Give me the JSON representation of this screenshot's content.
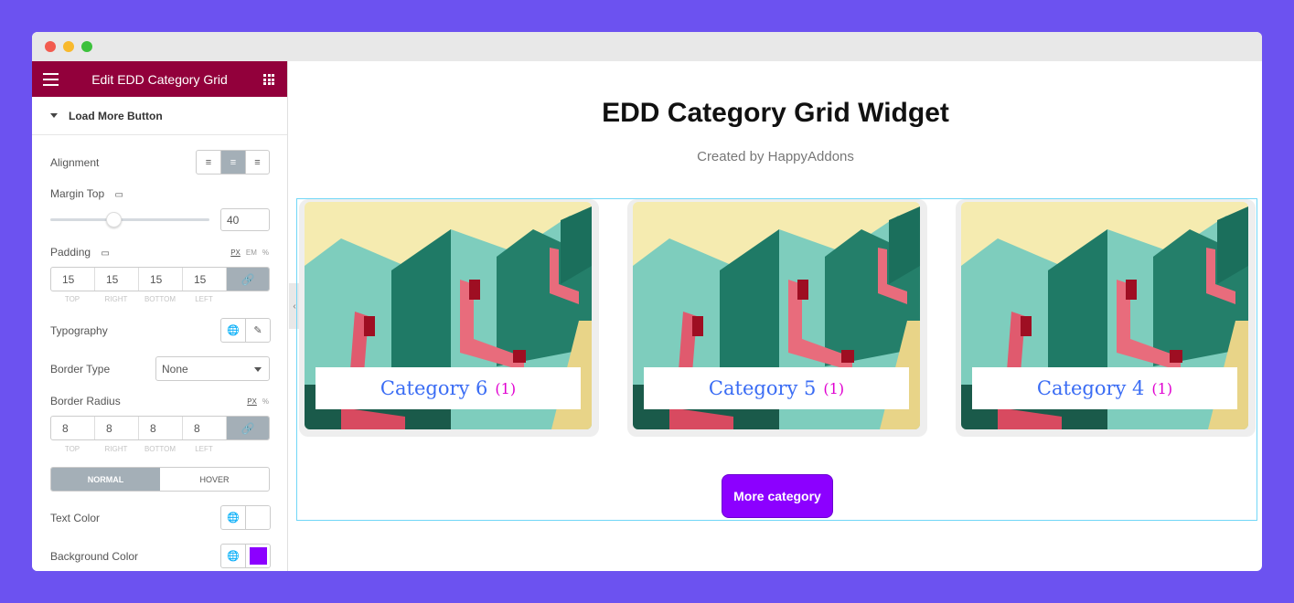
{
  "panel": {
    "title": "Edit EDD Category Grid",
    "section": "Load More Button",
    "alignment_label": "Alignment",
    "margin_top_label": "Margin Top",
    "margin_top_value": "40",
    "margin_top_slider_value": 40,
    "padding_label": "Padding",
    "padding_units": [
      "PX",
      "EM",
      "%"
    ],
    "padding": [
      "15",
      "15",
      "15",
      "15"
    ],
    "dim_labels": [
      "TOP",
      "RIGHT",
      "BOTTOM",
      "LEFT"
    ],
    "typography_label": "Typography",
    "border_type_label": "Border Type",
    "border_type_value": "None",
    "border_radius_label": "Border Radius",
    "radius_units": [
      "PX",
      "%"
    ],
    "radius": [
      "8",
      "8",
      "8",
      "8"
    ],
    "tab_normal": "NORMAL",
    "tab_hover": "HOVER",
    "text_color_label": "Text Color",
    "bg_color_label": "Background Color",
    "text_color": "#ffffff",
    "bg_color": "#8c00ff",
    "header_color": "#92003b"
  },
  "main": {
    "title": "EDD Category Grid Widget",
    "subtitle": "Created by HappyAddons",
    "cards": [
      {
        "name": "Category 6",
        "count": "(1)"
      },
      {
        "name": "Category 5",
        "count": "(1)"
      },
      {
        "name": "Category 4",
        "count": "(1)"
      }
    ],
    "button": "More category"
  }
}
